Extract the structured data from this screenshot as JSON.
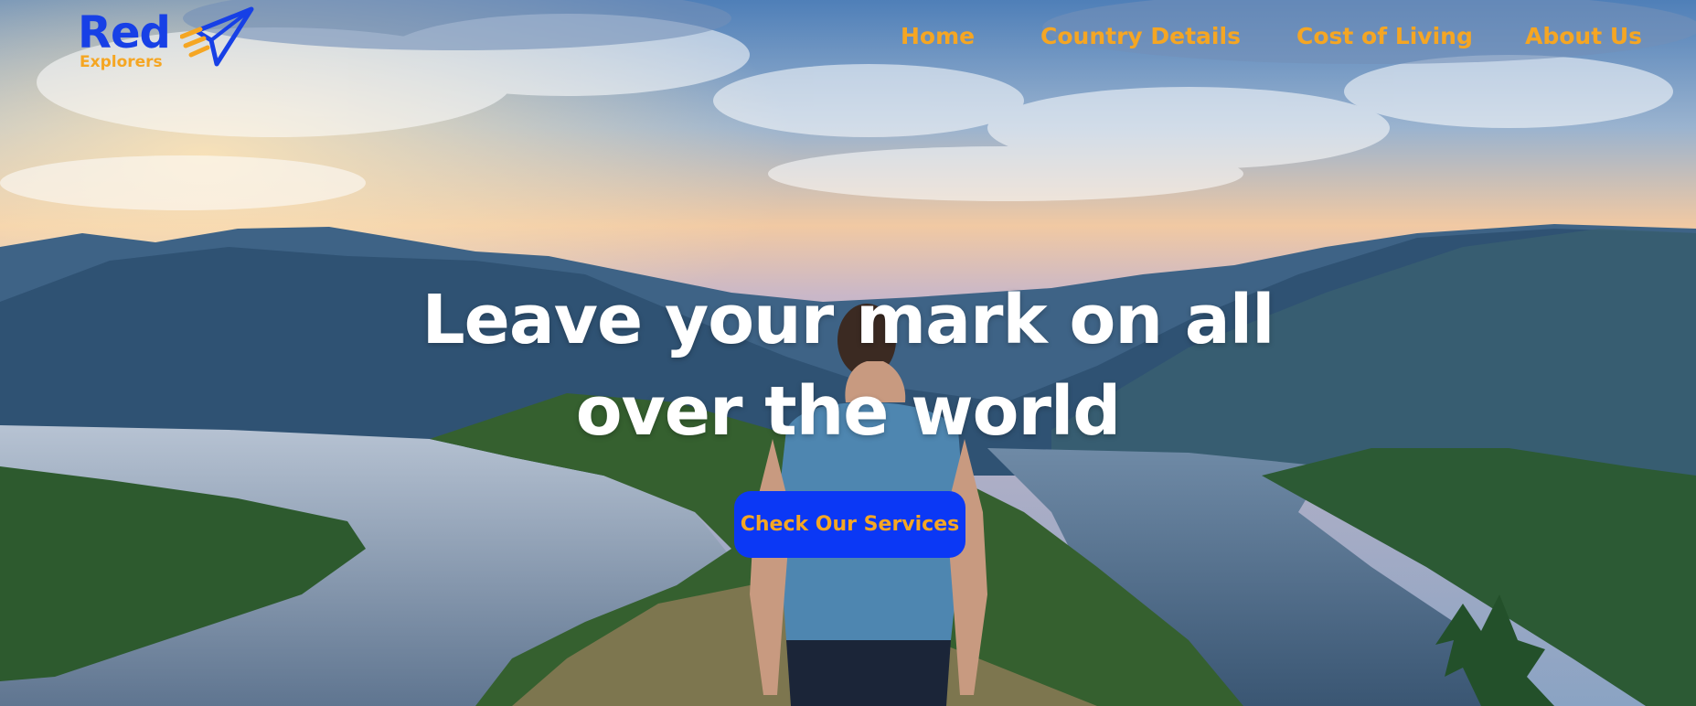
{
  "brand": {
    "name": "Red",
    "subtitle": "Explorers",
    "primary_color": "#1740e6",
    "accent_color": "#f5a623",
    "logo_icon": "paper-plane-icon"
  },
  "nav": {
    "items": [
      {
        "label": "Home"
      },
      {
        "label": "Country Details"
      },
      {
        "label": "Cost of Living"
      },
      {
        "label": "About Us"
      }
    ]
  },
  "hero": {
    "headline_line1": "Leave your mark on all",
    "headline_line2": "over the world",
    "cta_label": "Check Our Services",
    "cta_color": "#0b38f5",
    "background": "traveler-overlooking-river-valley-at-sunset-photo"
  }
}
